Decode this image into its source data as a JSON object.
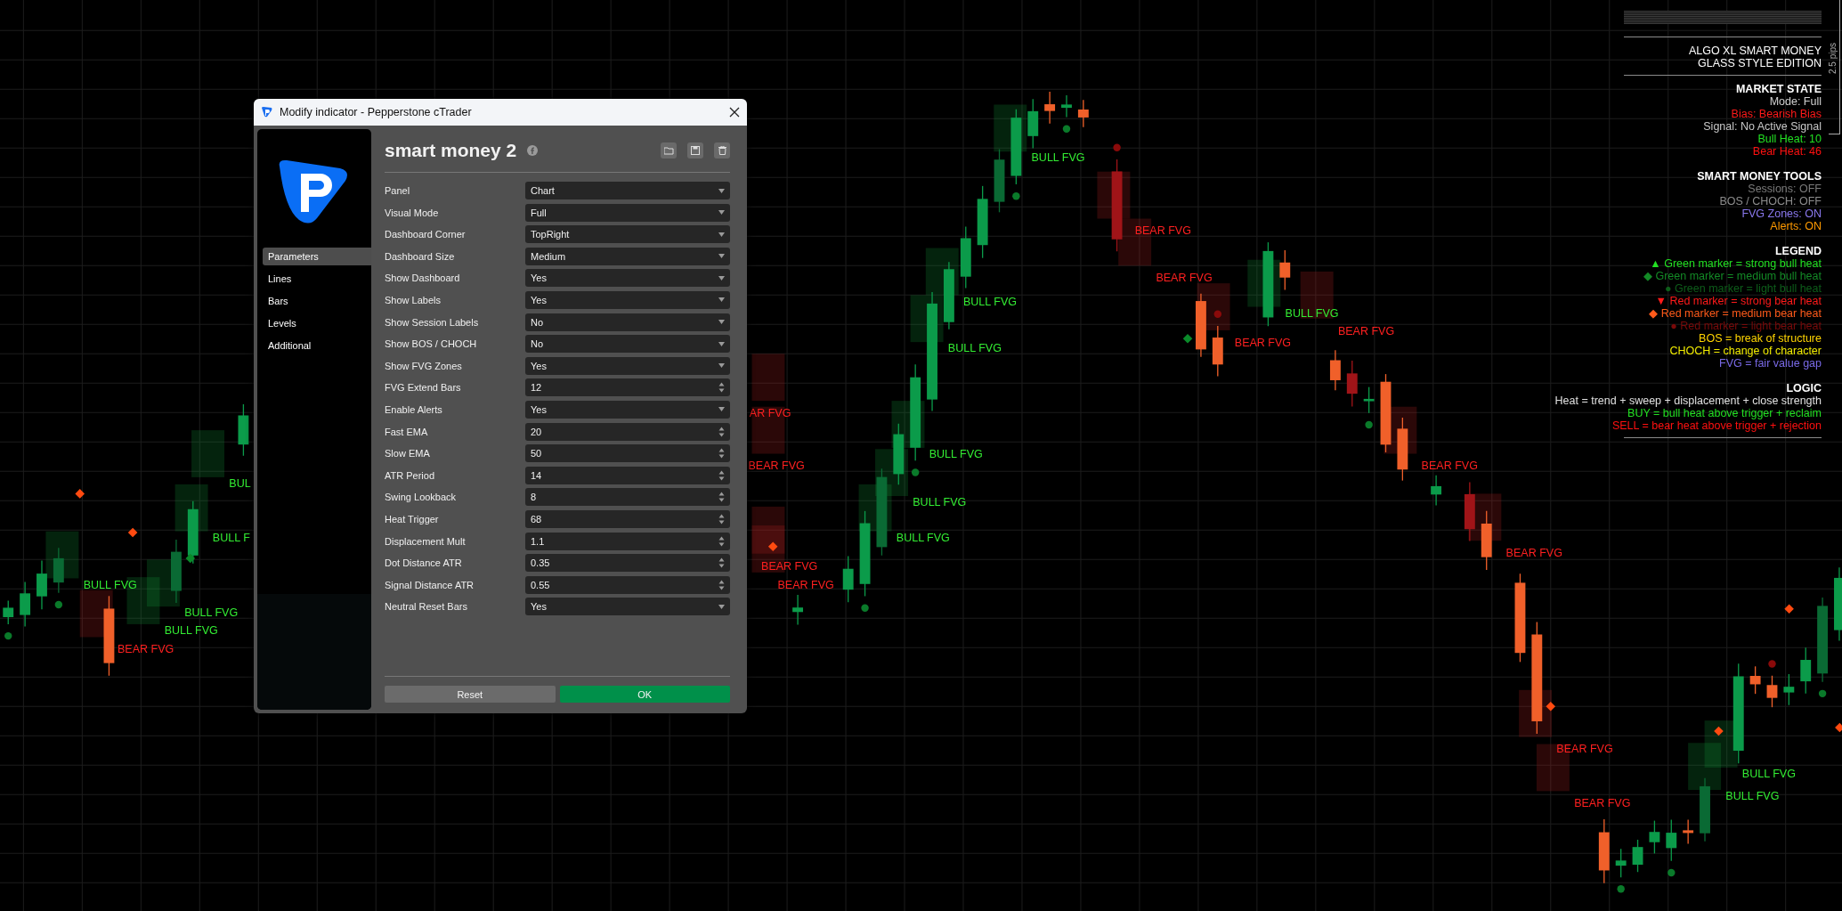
{
  "chart": {
    "labels": [
      {
        "text": "BULL FVG",
        "kind": "bull"
      },
      {
        "text": "BULL FVG",
        "kind": "bull"
      },
      {
        "text": "BULL FVG",
        "kind": "bull"
      },
      {
        "text": "BEAR FVG",
        "kind": "bear"
      },
      {
        "text": "BUL",
        "kind": "bull"
      },
      {
        "text": "BULL F",
        "kind": "bull"
      },
      {
        "text": "AR FVG",
        "kind": "bear"
      },
      {
        "text": "BEAR FVG",
        "kind": "bear"
      },
      {
        "text": "BEAR FVG",
        "kind": "bear"
      },
      {
        "text": "BEAR FVG",
        "kind": "bear"
      },
      {
        "text": "BULL FVG",
        "kind": "bull"
      },
      {
        "text": "BEAR FVG",
        "kind": "bear"
      },
      {
        "text": "BEAR FVG",
        "kind": "bear"
      },
      {
        "text": "BULL FVG",
        "kind": "bull"
      },
      {
        "text": "BULL FVG",
        "kind": "bull"
      },
      {
        "text": "BULL FVG",
        "kind": "bull"
      },
      {
        "text": "BULL FVG",
        "kind": "bull"
      },
      {
        "text": "BULL FVG",
        "kind": "bull"
      },
      {
        "text": "BEAR FVG",
        "kind": "bear"
      },
      {
        "text": "BULL FVG",
        "kind": "bull"
      },
      {
        "text": "BEAR FVG",
        "kind": "bear"
      },
      {
        "text": "BEAR FVG",
        "kind": "bear"
      },
      {
        "text": "BEAR FVG",
        "kind": "bear"
      },
      {
        "text": "BEAR FVG",
        "kind": "bear"
      },
      {
        "text": "BEAR FVG",
        "kind": "bear"
      },
      {
        "text": "BULL FVG",
        "kind": "bull"
      },
      {
        "text": "BULL FVG",
        "kind": "bull"
      }
    ]
  },
  "dashboard": {
    "title": [
      "ALGO XL SMART MONEY",
      "GLASS STYLE EDITION"
    ],
    "scale_label": "2.5 pips",
    "sections": [
      {
        "heading": "MARKET STATE",
        "lines": [
          {
            "text": "Mode: Full",
            "color": "#d0d0d0"
          },
          {
            "text": "Bias: Bearish Bias",
            "color": "#ff1a1a"
          },
          {
            "text": "Signal: No Active Signal",
            "color": "#c8c8c8"
          },
          {
            "text": "Bull Heat: 10",
            "color": "#22e022"
          },
          {
            "text": "Bear Heat: 46",
            "color": "#ff1010"
          }
        ]
      },
      {
        "heading": "SMART MONEY TOOLS",
        "lines": [
          {
            "text": "Sessions: OFF",
            "color": "#7a7a7a"
          },
          {
            "text": "BOS / CHOCH: OFF",
            "color": "#8c8c8c"
          },
          {
            "text": "FVG Zones: ON",
            "color": "#8a78ee"
          },
          {
            "text": "Alerts: ON",
            "color": "#ff9a00"
          }
        ]
      },
      {
        "heading": "LEGEND",
        "lines": [
          {
            "text": "▲ Green marker = strong bull heat",
            "color": "#22e022"
          },
          {
            "text": "◆ Green marker = medium bull heat",
            "color": "#138a26"
          },
          {
            "text": "● Green marker = light bull heat",
            "color": "#0d5e1a"
          },
          {
            "text": "▼ Red marker = strong bear heat",
            "color": "#ff1a1a"
          },
          {
            "text": "◆ Red marker = medium bear heat",
            "color": "#ff5a1a"
          },
          {
            "text": "● Red marker = light bear heat",
            "color": "#7a0a0a"
          },
          {
            "text": "BOS = break of structure",
            "color": "#ffd400"
          },
          {
            "text": "CHOCH = change of character",
            "color": "#f2ec00"
          },
          {
            "text": "FVG = fair value gap",
            "color": "#7a6ae8"
          }
        ]
      },
      {
        "heading": "LOGIC",
        "lines": [
          {
            "text": "Heat = trend + sweep + displacement + close strength",
            "color": "#e0e0e0"
          },
          {
            "text": "BUY = bull heat above trigger + reclaim",
            "color": "#22e022"
          },
          {
            "text": "SELL = bear heat above trigger + rejection",
            "color": "#ff1010"
          }
        ]
      }
    ]
  },
  "dialog": {
    "title": "Modify indicator - Pepperstone cTrader",
    "indicator_name": "smart money 2",
    "nav": [
      {
        "label": "Parameters",
        "selected": true
      },
      {
        "label": "Lines",
        "selected": false
      },
      {
        "label": "Bars",
        "selected": false
      },
      {
        "label": "Levels",
        "selected": false
      },
      {
        "label": "Additional",
        "selected": false
      }
    ],
    "parameters": [
      {
        "label": "Panel",
        "value": "Chart",
        "kind": "select"
      },
      {
        "label": "Visual Mode",
        "value": "Full",
        "kind": "select"
      },
      {
        "label": "Dashboard Corner",
        "value": "TopRight",
        "kind": "select"
      },
      {
        "label": "Dashboard Size",
        "value": "Medium",
        "kind": "select"
      },
      {
        "label": "Show Dashboard",
        "value": "Yes",
        "kind": "select"
      },
      {
        "label": "Show Labels",
        "value": "Yes",
        "kind": "select"
      },
      {
        "label": "Show Session Labels",
        "value": "No",
        "kind": "select"
      },
      {
        "label": "Show BOS / CHOCH",
        "value": "No",
        "kind": "select"
      },
      {
        "label": "Show FVG Zones",
        "value": "Yes",
        "kind": "select"
      },
      {
        "label": "FVG Extend Bars",
        "value": "12",
        "kind": "number"
      },
      {
        "label": "Enable Alerts",
        "value": "Yes",
        "kind": "select"
      },
      {
        "label": "Fast EMA",
        "value": "20",
        "kind": "number"
      },
      {
        "label": "Slow EMA",
        "value": "50",
        "kind": "number"
      },
      {
        "label": "ATR Period",
        "value": "14",
        "kind": "number"
      },
      {
        "label": "Swing Lookback",
        "value": "8",
        "kind": "number"
      },
      {
        "label": "Heat Trigger",
        "value": "68",
        "kind": "number"
      },
      {
        "label": "Displacement Mult",
        "value": "1.1",
        "kind": "number"
      },
      {
        "label": "Dot Distance ATR",
        "value": "0.35",
        "kind": "number"
      },
      {
        "label": "Signal Distance ATR",
        "value": "0.55",
        "kind": "number"
      },
      {
        "label": "Neutral Reset Bars",
        "value": "Yes",
        "kind": "select"
      }
    ],
    "buttons": [
      {
        "label": "Reset",
        "kind": "secondary"
      },
      {
        "label": "OK",
        "kind": "primary"
      }
    ]
  }
}
